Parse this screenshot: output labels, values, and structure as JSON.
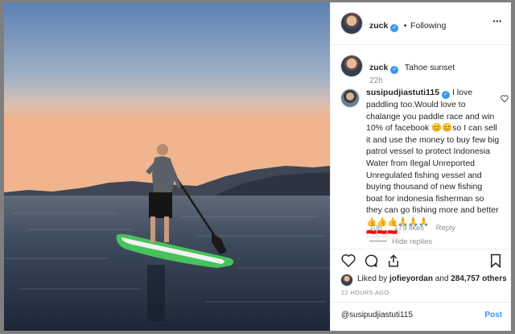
{
  "header": {
    "username": "zuck",
    "separator": "•",
    "follow_label": "Following",
    "more": "•••"
  },
  "caption": {
    "username": "zuck",
    "text": "Tahoe sunset",
    "time": "22h"
  },
  "comment": {
    "username": "susipudjiastuti115",
    "text": "I love paddling too.Would love to chalange you paddle race and win 10% of facebook 😊😊so I can sell it and use the money to buy few big patrol vessel to protect Indonesia Water from Ilegal Unreported Unregulated fishing vessel and buying thousand of new fishing boat for indonesia fisherman so they can go fishing more and better👍👍👍🙏🙏🙏",
    "flags": "🇮🇩🇮🇩🇮🇩",
    "time": "10h",
    "likes": "179 likes",
    "reply": "Reply",
    "hide_replies": "Hide replies"
  },
  "likes": {
    "prefix": "Liked by",
    "user": "jofieyordan",
    "middle": "and",
    "count": "284,757 others"
  },
  "timestamp": "22 HOURS AGO",
  "composer": {
    "value": "@susipudjiastuti115",
    "post_label": "Post"
  },
  "colors": {
    "link": "#3897f0",
    "verified": "#3897f0"
  }
}
